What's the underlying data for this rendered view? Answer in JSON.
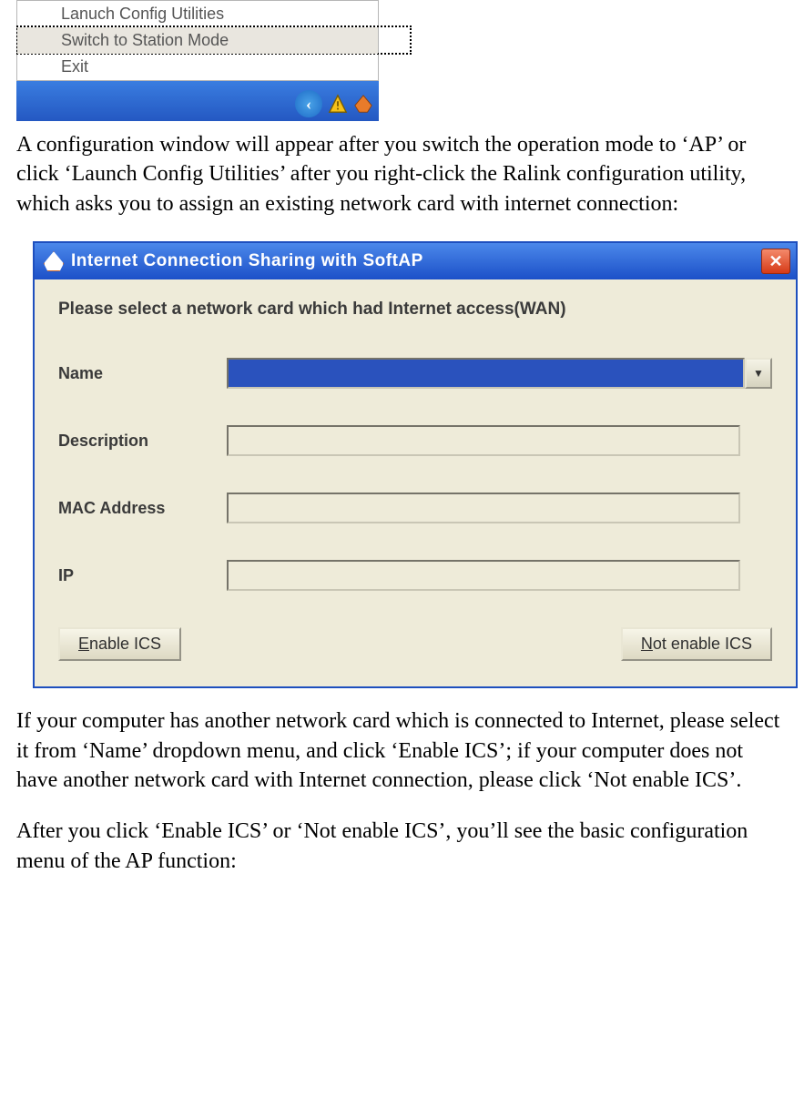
{
  "context_menu": {
    "items": [
      "Lanuch Config Utilities",
      "Switch to Station Mode",
      "Exit"
    ]
  },
  "doc": {
    "para1": "A configuration window will appear after you switch the operation mode to ‘AP’ or click ‘Launch Config Utilities’ after you right-click the Ralink configuration utility, which asks you to assign an existing network card with internet connection:",
    "para2": "If your computer has another network card which is connected to Internet, please select it from ‘Name’ dropdown menu, and click ‘Enable ICS’; if your computer does not have another network card with Internet connection, please click ‘Not enable ICS’.",
    "para3": "After you click ‘Enable ICS’ or ‘Not enable ICS’, you’ll see the basic configuration menu of the AP function:"
  },
  "dialog": {
    "title": "Internet  Connection Sharing with SoftAP",
    "prompt": "Please select a network card which had Internet access(WAN)",
    "labels": {
      "name": "Name",
      "description": "Description",
      "mac": "MAC Address",
      "ip": "IP"
    },
    "fields": {
      "name": "",
      "description": "",
      "mac": "",
      "ip": ""
    },
    "buttons": {
      "enable_u": "E",
      "enable_rest": "nable ICS",
      "notenable_u": "N",
      "notenable_rest": "ot enable ICS"
    }
  }
}
